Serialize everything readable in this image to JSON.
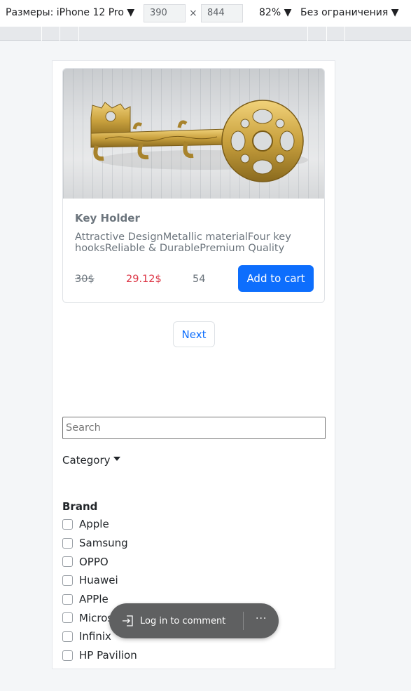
{
  "devtools": {
    "device_label": "Размеры: iPhone 12 Pro ▼",
    "width": "390",
    "times": "×",
    "height": "844",
    "zoom": "82% ▼",
    "throttle": "Без ограничения ▼"
  },
  "product": {
    "title": "Key Holder",
    "description": "Attractive DesignMetallic materialFour key hooksReliable & DurablePremium Quality",
    "old_price": "30$",
    "new_price": "29.12$",
    "stock": "54",
    "add_button": "Add to cart"
  },
  "pagination": {
    "next": "Next"
  },
  "search": {
    "placeholder": "Search"
  },
  "filters": {
    "category_label": "Category",
    "brand_title": "Brand",
    "brands": [
      {
        "label": "Apple"
      },
      {
        "label": "Samsung"
      },
      {
        "label": "OPPO"
      },
      {
        "label": "Huawei"
      },
      {
        "label": "APPle"
      },
      {
        "label": "Microsoft"
      },
      {
        "label": "Infinix"
      },
      {
        "label": "HP Pavilion"
      }
    ]
  },
  "overlay": {
    "login_label": "Log in to comment",
    "more_label": "···"
  },
  "colors": {
    "primary": "#0d6efd",
    "sale": "#dc3545",
    "muted": "#6c757d"
  }
}
